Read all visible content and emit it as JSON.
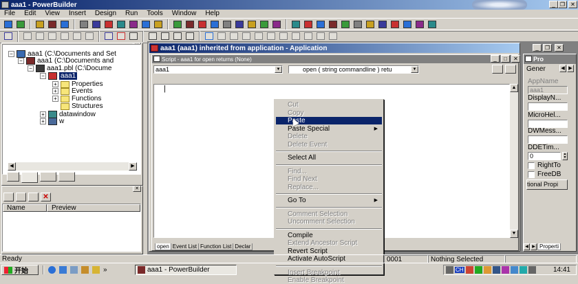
{
  "window": {
    "title": "aaa1 - PowerBuilder",
    "min": "_",
    "restore": "❐",
    "close": "✕"
  },
  "menu": [
    "File",
    "Edit",
    "View",
    "Insert",
    "Design",
    "Run",
    "Tools",
    "Window",
    "Help"
  ],
  "tree": {
    "items": [
      {
        "label": "aaa1 (C:\\Documents and Set",
        "expander": "−"
      },
      {
        "label": "aaa1 (C:\\Documents and",
        "expander": "−"
      },
      {
        "label": "aaa1.pbl (C:\\Docume",
        "expander": "−"
      },
      {
        "label": "aaa1",
        "expander": "−"
      },
      {
        "label": "Properties",
        "expander": "+"
      },
      {
        "label": "Events",
        "expander": "+"
      },
      {
        "label": "Functions",
        "expander": "+"
      },
      {
        "label": "Structures",
        "expander": ""
      },
      {
        "label": "datawindow",
        "expander": "+"
      },
      {
        "label": "w",
        "expander": "+"
      }
    ]
  },
  "output": {
    "columns": [
      "Name",
      "Preview"
    ]
  },
  "app_window": {
    "title": "aaa1 (aaa1) inherited from application - Application"
  },
  "script_window": {
    "title": "Script - aaa1 for open returns (None)",
    "object_dropdown": "aaa1",
    "event_dropdown": "open ( string commandline ) retu",
    "cursor": "|",
    "tabs": [
      "open",
      "Event List",
      "Function List",
      "Declar"
    ]
  },
  "properties": {
    "title": "Pro",
    "tab": "Gener",
    "fields": [
      {
        "label": "AppName",
        "value": "aaa1"
      },
      {
        "label": "DisplayN...",
        "value": ""
      },
      {
        "label": "MicroHel...",
        "value": ""
      },
      {
        "label": "DWMess...",
        "value": ""
      },
      {
        "label": "DDETim...",
        "value": "0"
      }
    ],
    "checks": [
      "RightTo",
      "FreeDB"
    ],
    "button": "tional Propi",
    "bottom_tab": "Properti"
  },
  "context_menu": {
    "items": [
      {
        "label": "Cut",
        "enabled": false
      },
      {
        "label": "Copy",
        "enabled": false
      },
      {
        "label": "Paste",
        "enabled": true,
        "highlighted": true
      },
      {
        "label": "Paste Special",
        "enabled": true,
        "submenu": true
      },
      {
        "label": "Delete",
        "enabled": false
      },
      {
        "label": "Delete Event",
        "enabled": false
      },
      {
        "sep": true
      },
      {
        "label": "Select All",
        "enabled": true
      },
      {
        "sep": true
      },
      {
        "label": "Find...",
        "enabled": false
      },
      {
        "label": "Find Next",
        "enabled": false
      },
      {
        "label": "Replace...",
        "enabled": false
      },
      {
        "sep": true
      },
      {
        "label": "Go To",
        "enabled": true,
        "submenu": true
      },
      {
        "sep": true
      },
      {
        "label": "Comment Selection",
        "enabled": false
      },
      {
        "label": "Uncomment Selection",
        "enabled": false
      },
      {
        "sep": true
      },
      {
        "label": "Compile",
        "enabled": true
      },
      {
        "label": "Extend Ancestor Script",
        "enabled": false
      },
      {
        "label": "Revert Script",
        "enabled": true
      },
      {
        "label": "Activate AutoScript",
        "enabled": true
      },
      {
        "sep": true
      },
      {
        "label": "Insert Breakpoint",
        "enabled": false
      },
      {
        "label": "Enable Breakpoint",
        "enabled": false
      }
    ]
  },
  "status": {
    "text": "Ready",
    "position": "0001",
    "selection": "Nothing Selected"
  },
  "taskbar": {
    "start": "开始",
    "quick_more": "»",
    "app": "aaa1 - PowerBuilder",
    "tray_lang": "CH",
    "clock": "14:41"
  }
}
